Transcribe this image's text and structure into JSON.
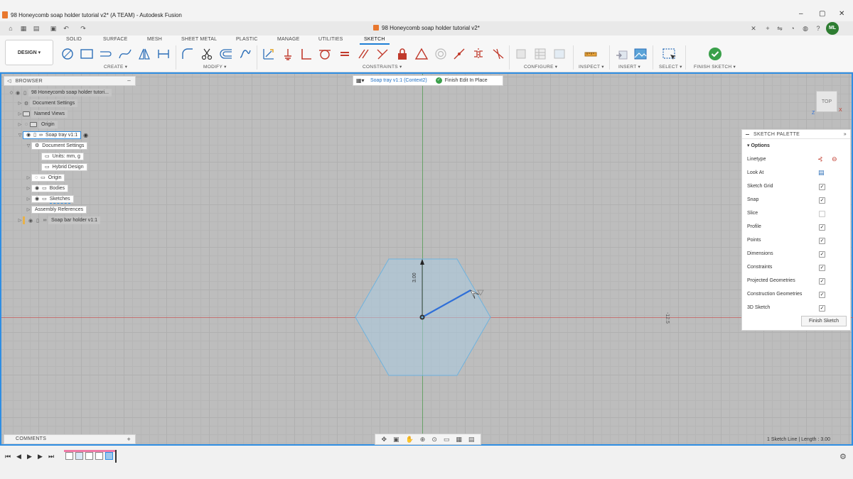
{
  "window": {
    "title": "98 Honeycomb soap holder tutorial v2* (A TEAM) - Autodesk Fusion",
    "controls": [
      "–",
      "▢",
      "✕"
    ]
  },
  "quick_access": {
    "doc_tab": "98 Honeycomb soap holder tutorial v2*",
    "user_initials": "ML"
  },
  "ribbon": {
    "design_label": "DESIGN ▾",
    "tabs": [
      "SOLID",
      "SURFACE",
      "MESH",
      "SHEET METAL",
      "PLASTIC",
      "MANAGE",
      "UTILITIES",
      "SKETCH"
    ],
    "groups": {
      "create": "CREATE ▾",
      "modify": "MODIFY ▾",
      "constraints": "CONSTRAINTS ▾",
      "configure": "CONFIGURE ▾",
      "inspect": "INSPECT ▾",
      "insert": "INSERT ▾",
      "select": "SELECT ▾",
      "finish_sketch": "FINISH SKETCH ▾"
    }
  },
  "browser": {
    "header": "BROWSER",
    "items": [
      {
        "label": "98 Honeycomb soap holder tutori..."
      },
      {
        "label": "Document Settings"
      },
      {
        "label": "Named Views"
      },
      {
        "label": "Origin"
      },
      {
        "label": "Soap tray v1:1"
      },
      {
        "label": "Document Settings"
      },
      {
        "label": "Units: mm, g"
      },
      {
        "label": "Hybrid Design"
      },
      {
        "label": "Origin"
      },
      {
        "label": "Bodies"
      },
      {
        "label": "Sketches"
      },
      {
        "label": "Assembly References"
      },
      {
        "label": "Soap bar holder v1:1"
      }
    ]
  },
  "context_bar": {
    "context": "Soap tray v1:1 (Context2)",
    "finish": "Finish Edit In Place"
  },
  "viewcube": {
    "face": "TOP"
  },
  "sketch": {
    "dimension_label": "3.00",
    "side_label": "-12.5"
  },
  "palette": {
    "header": "SKETCH PALETTE",
    "section": "Options",
    "rows": [
      {
        "label": "Linetype",
        "type": "icons"
      },
      {
        "label": "Look At",
        "type": "icon"
      },
      {
        "label": "Sketch Grid",
        "type": "check",
        "checked": true
      },
      {
        "label": "Snap",
        "type": "check",
        "checked": true
      },
      {
        "label": "Slice",
        "type": "check",
        "checked": false
      },
      {
        "label": "Profile",
        "type": "check",
        "checked": true
      },
      {
        "label": "Points",
        "type": "check",
        "checked": true
      },
      {
        "label": "Dimensions",
        "type": "check",
        "checked": true
      },
      {
        "label": "Constraints",
        "type": "check",
        "checked": true
      },
      {
        "label": "Projected Geometries",
        "type": "check",
        "checked": true
      },
      {
        "label": "Construction Geometries",
        "type": "check",
        "checked": true
      },
      {
        "label": "3D Sketch",
        "type": "check",
        "checked": true
      }
    ],
    "finish_button": "Finish Sketch"
  },
  "comments": {
    "label": "COMMENTS"
  },
  "status": {
    "text": "1 Sketch Line | Length : 3.00"
  },
  "colors": {
    "accent": "#2f8ee3",
    "sketch_line": "#2f6fd8",
    "hexagon_fill": "#a9cbe0",
    "finish_green": "#3aa04a"
  }
}
